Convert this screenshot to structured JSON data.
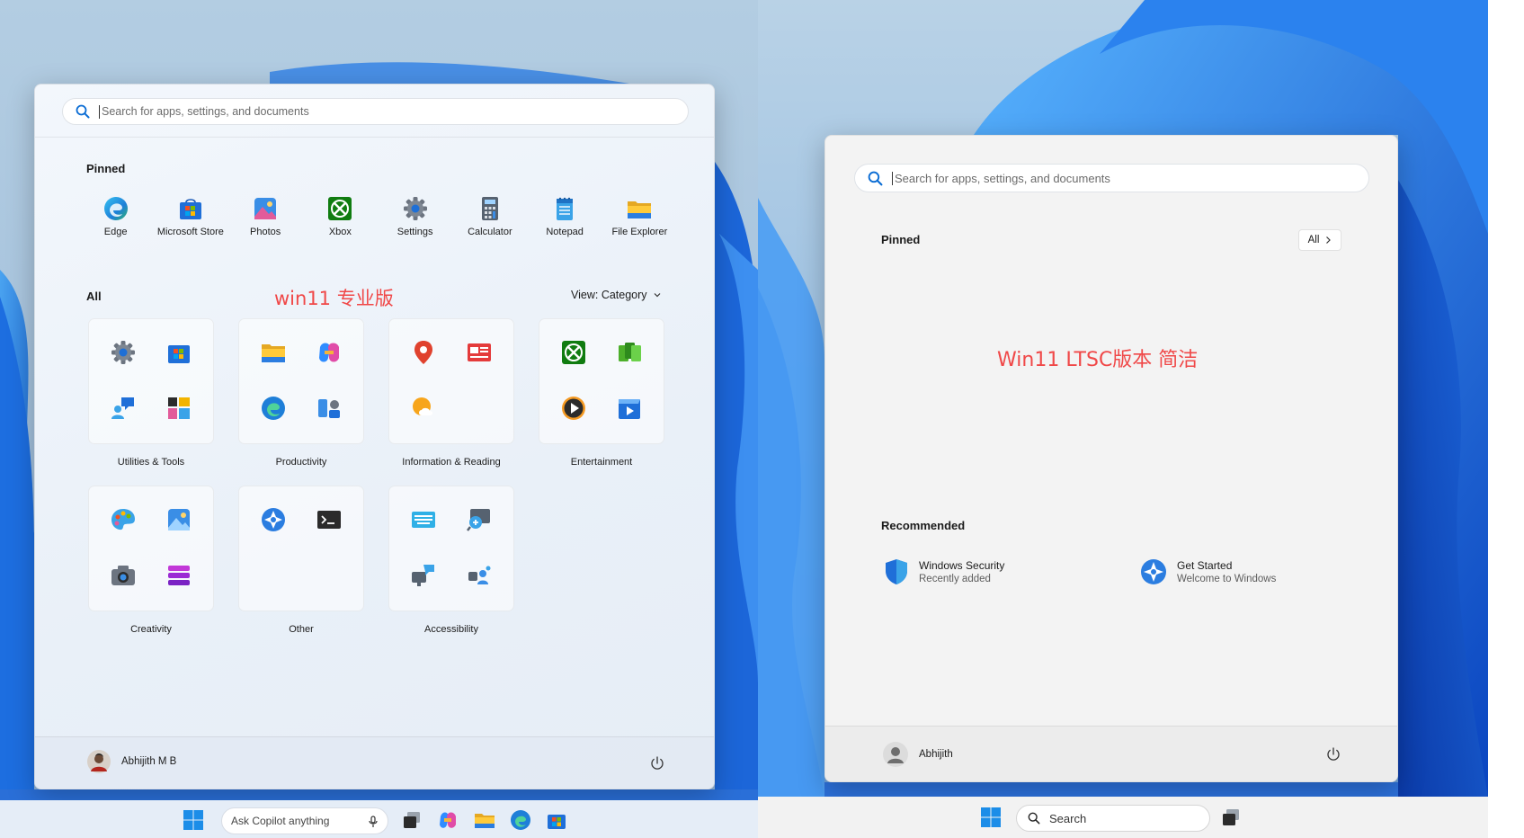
{
  "left_panel": {
    "search_placeholder": "Search for apps, settings, and documents",
    "pinned_title": "Pinned",
    "pinned": [
      {
        "label": "Edge",
        "icon": "edge-icon"
      },
      {
        "label": "Microsoft Store",
        "icon": "store-icon"
      },
      {
        "label": "Photos",
        "icon": "photos-icon"
      },
      {
        "label": "Xbox",
        "icon": "xbox-icon"
      },
      {
        "label": "Settings",
        "icon": "gear-icon"
      },
      {
        "label": "Calculator",
        "icon": "calculator-icon"
      },
      {
        "label": "Notepad",
        "icon": "notepad-icon"
      },
      {
        "label": "File Explorer",
        "icon": "folder-icon"
      }
    ],
    "all_title": "All",
    "annotation": "win11 专业版",
    "view_label": "View: Category",
    "categories": [
      {
        "label": "Utilities & Tools"
      },
      {
        "label": "Productivity"
      },
      {
        "label": "Information & Reading"
      },
      {
        "label": "Entertainment"
      },
      {
        "label": "Creativity"
      },
      {
        "label": "Other"
      },
      {
        "label": "Accessibility"
      }
    ],
    "user_name": "Abhijith M B"
  },
  "right_panel": {
    "search_placeholder": "Search for apps, settings, and documents",
    "pinned_title": "Pinned",
    "all_button": "All",
    "annotation": "Win11 LTSC版本 简洁",
    "recommended_title": "Recommended",
    "recommended": [
      {
        "title": "Windows Security",
        "subtitle": "Recently added"
      },
      {
        "title": "Get Started",
        "subtitle": "Welcome to Windows"
      }
    ],
    "user_name": "Abhijith"
  },
  "taskbar_left": {
    "copilot_placeholder": "Ask Copilot anything"
  },
  "taskbar_right": {
    "search_label": "Search"
  },
  "colors": {
    "accent": "#0a6cd4",
    "annotation": "#f04848"
  }
}
